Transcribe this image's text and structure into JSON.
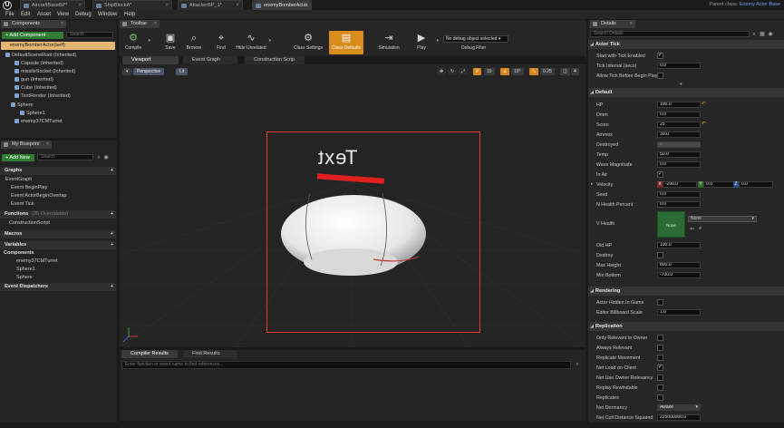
{
  "tabs": {
    "items": [
      {
        "label": "AircraftBaseBP*"
      },
      {
        "label": "ShipBlockA*"
      },
      {
        "label": "AttackerBP_1*"
      },
      {
        "label": "enemyBomberActor"
      }
    ],
    "parent_class_prefix": "Parent class:",
    "parent_class_value": "Enemy Actor Base"
  },
  "menu": [
    "File",
    "Edit",
    "Asset",
    "View",
    "Debug",
    "Window",
    "Help"
  ],
  "components": {
    "tab_label": "Components",
    "add_label": "+ Add Component",
    "search_placeholder": "Search",
    "root_label": "enemyBomberActor(self)",
    "tree": [
      "DefaultSceneRoot (Inherited)",
      "Capsule (Inherited)",
      "missileSocket (Inherited)",
      "gun (Inherited)",
      "Cube (Inherited)",
      "TextRender (Inherited)",
      "Sphere",
      "Sphere1",
      "enemy37CMTurret"
    ]
  },
  "my_blueprint": {
    "tab_label": "My Blueprint",
    "add_label": "+ Add New",
    "search_placeholder": "Search",
    "graphs_header": "Graphs",
    "event_graph": "EventGraph",
    "events": [
      "Event BeginPlay",
      "Event ActorBeginOverlap",
      "Event Tick"
    ],
    "functions_header": "Functions",
    "functions_sub": "(25 Overridable)",
    "functions": [
      "ConstructionScript"
    ],
    "macros_header": "Macros",
    "variables_header": "Variables",
    "components_header": "Components",
    "components": [
      "enemy37CMTurret",
      "Sphere1",
      "Sphere"
    ],
    "dispatchers_header": "Event Dispatchers"
  },
  "toolbar": {
    "tab_label": "Toolbar",
    "buttons": [
      {
        "label": "Compile",
        "glyph": "⚙"
      },
      {
        "label": "Save",
        "glyph": "▣"
      },
      {
        "label": "Browse",
        "glyph": "⌕"
      },
      {
        "label": "Find",
        "glyph": "⌖"
      },
      {
        "label": "Hide Unrelated",
        "glyph": "∿"
      },
      {
        "label": "Class Settings",
        "glyph": "⚙"
      },
      {
        "label": "Class Defaults",
        "glyph": "▤"
      },
      {
        "label": "Simulation",
        "glyph": "⇥"
      },
      {
        "label": "Play",
        "glyph": "▶"
      }
    ],
    "debug_select": "No debug object selected",
    "debug_filter": "Debug Filter"
  },
  "viewport": {
    "tabs": [
      "Viewport",
      "Event Graph",
      "Construction Scrip"
    ],
    "perspective": "Perspective",
    "lit": "Lit",
    "grid_snap": "10",
    "rot_snap": "10°",
    "scale_snap": "0.25",
    "cam_speed": "4",
    "text_render": "Text"
  },
  "bottom": {
    "tabs": [
      "Compiler Results",
      "Find Results"
    ],
    "find_placeholder": "Enter function or event name to find references..."
  },
  "details": {
    "tab_label": "Details",
    "search_placeholder": "Search Details",
    "actor_tick_header": "Actor Tick",
    "start_tick_label": "Start with Tick Enabled",
    "tick_interval_label": "Tick Interval (secs)",
    "tick_interval_value": "0.0",
    "allow_tick_label": "Allow Tick Before Begin Play",
    "default_header": "Default",
    "props": [
      {
        "label": "HP",
        "value": "100.0"
      },
      {
        "label": "Dmm",
        "value": "0.0"
      },
      {
        "label": "Score",
        "value": "25"
      },
      {
        "label": "Ammox",
        "value": "30.0"
      },
      {
        "label": "Destroyed",
        "value": "0"
      },
      {
        "label": "Temp",
        "value": "50.0"
      },
      {
        "label": "Wave Magnitude",
        "value": "0.0"
      }
    ],
    "in_air_label": "In Air",
    "velocity_label": "Velocity",
    "velocity": {
      "x": "-200.0",
      "y": "0.0",
      "z": "0.0"
    },
    "seed_label": "Seed",
    "seed_value": "0.0",
    "health_pct_label": "N Health Percent",
    "health_pct_value": "0.0",
    "vhealth_label": "V Health",
    "vhealth_thumb": "None",
    "vhealth_select": "None",
    "old_hp_label": "Old HP",
    "old_hp_value": "100.0",
    "destroy_label": "Destroy",
    "max_height_label": "Max Height",
    "max_height_value": "800.0",
    "min_bottom_label": "Min Bottom",
    "min_bottom_value": "-700.0",
    "rendering_header": "Rendering",
    "actor_hidden_label": "Actor Hidden In Game",
    "billboard_label": "Editor Billboard Scale",
    "billboard_value": "1.0",
    "replication_header": "Replication",
    "repl_props": [
      "Only Relevant to Owner",
      "Always Relevant",
      "Replicate Movement",
      "Net Load on Client",
      "Net Use Owner Relevancy",
      "Replay Rewindable",
      "Replicates"
    ],
    "net_dormancy_label": "Net Dormancy",
    "net_dormancy_value": "Awake",
    "net_cull_label": "Net Cull Distance Squared",
    "net_cull_value": "225000000.0"
  },
  "colors": {
    "accent_orange": "#d98c1c",
    "selection_red": "#e03a3a",
    "add_green": "#2e7d32",
    "link_blue": "#6ba4f2"
  }
}
